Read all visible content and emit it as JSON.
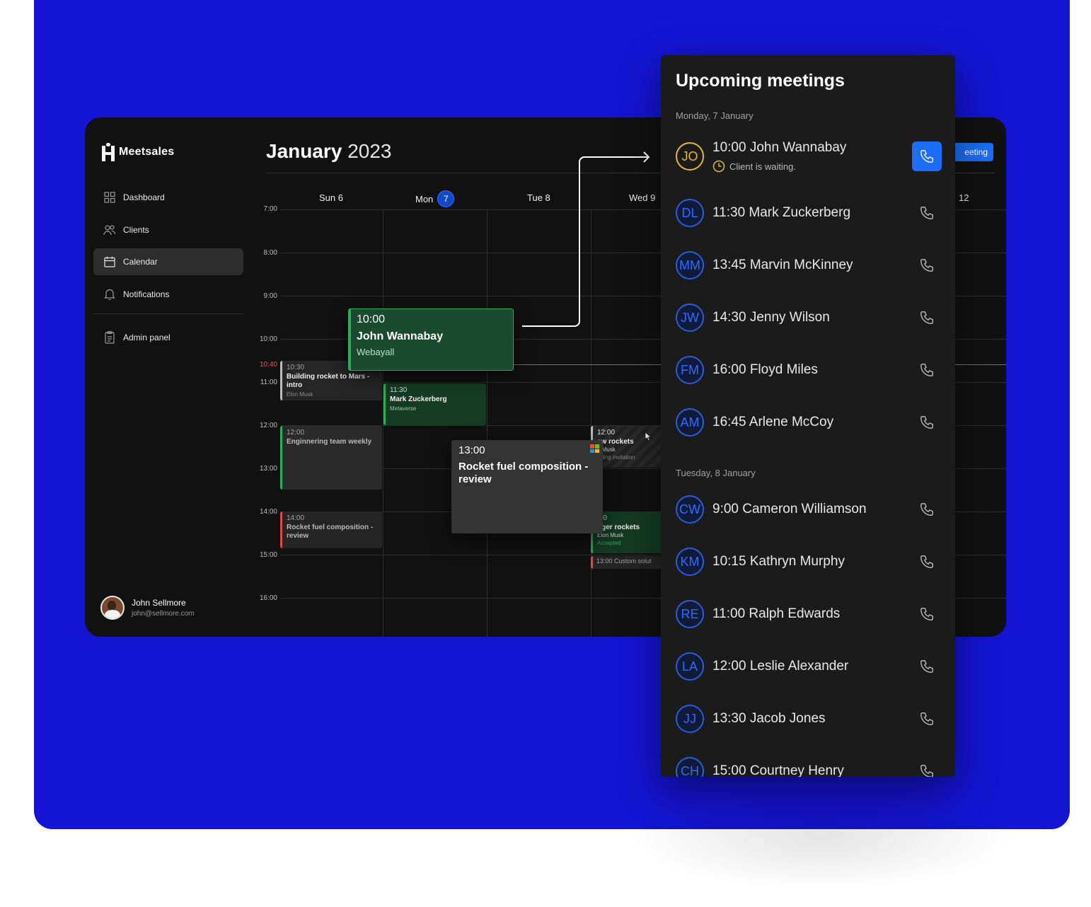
{
  "app": {
    "brand": "Meetsales",
    "nav": [
      {
        "label": "Dashboard",
        "icon": "grid-icon"
      },
      {
        "label": "Clients",
        "icon": "users-icon"
      },
      {
        "label": "Calendar",
        "icon": "calendar-icon",
        "active": true
      },
      {
        "label": "Notifications",
        "icon": "bell-icon"
      }
    ],
    "admin": {
      "label": "Admin panel",
      "icon": "clipboard-icon"
    },
    "user": {
      "name": "John Sellmore",
      "email": "john@sellmore.com"
    }
  },
  "calendar": {
    "month": "January",
    "year": "2023",
    "new_button": "eeting",
    "days": [
      {
        "label": "Sun 6"
      },
      {
        "label": "Mon",
        "badge": "7"
      },
      {
        "label": "Tue 8"
      },
      {
        "label": "Wed 9"
      },
      {
        "label": "12"
      }
    ],
    "times": [
      "7:00",
      "8:00",
      "9:00",
      "10:00",
      "11:00",
      "12:00",
      "13:00",
      "14:00",
      "15:00",
      "16:00"
    ],
    "now": "10:40",
    "events": {
      "building": {
        "time": "10:30",
        "title": "Building rocket to Mars - intro",
        "sub": "Elon Musk"
      },
      "markz": {
        "time": "11:30",
        "title": "Mark Zuckerberg",
        "sub": "Metaverse"
      },
      "eng": {
        "time": "12:00",
        "title": "Enginnering team weekly"
      },
      "rfc_small": {
        "time": "14:00",
        "title": "Rocket fuel composition - review"
      },
      "newrockets": {
        "time": "12:00",
        "title": "ew rockets",
        "sub": "n Musk",
        "sub2": "nding invitation"
      },
      "bigger": {
        "time": ":00",
        "title": "gger rockets",
        "sub": "Elon Musk",
        "sub2": "Accepted"
      },
      "custom": {
        "label": "13:00 Custom solut"
      }
    },
    "drag_green": {
      "time": "10:00",
      "name": "John Wannabay",
      "company": "Webayall"
    },
    "drag_gray": {
      "time": "13:00",
      "title": "Rocket fuel composition - review"
    }
  },
  "upcoming": {
    "title": "Upcoming meetings",
    "groups": [
      {
        "date": "Monday, 7 January"
      },
      {
        "date": "Tuesday, 8 January"
      }
    ],
    "first": {
      "initials": "JO",
      "text": "10:00 John Wannabay",
      "status": "Client is waiting."
    },
    "mon": [
      {
        "initials": "DL",
        "text": "11:30 Mark Zuckerberg"
      },
      {
        "initials": "MM",
        "text": "13:45 Marvin McKinney"
      },
      {
        "initials": "JW",
        "text": "14:30 Jenny Wilson"
      },
      {
        "initials": "FM",
        "text": "16:00 Floyd Miles"
      },
      {
        "initials": "AM",
        "text": "16:45 Arlene McCoy"
      }
    ],
    "tue": [
      {
        "initials": "CW",
        "text": "9:00 Cameron Williamson"
      },
      {
        "initials": "KM",
        "text": "10:15 Kathryn Murphy"
      },
      {
        "initials": "RE",
        "text": "11:00 Ralph Edwards"
      },
      {
        "initials": "LA",
        "text": "12:00 Leslie Alexander"
      },
      {
        "initials": "JJ",
        "text": "13:30 Jacob Jones"
      },
      {
        "initials": "CH",
        "text": "15:00 Courtney Henry"
      }
    ]
  },
  "colors": {
    "accent": "#1b6ef5",
    "background": "#1414d2",
    "waiting": "#e2b92d",
    "now_line": "#e34646",
    "event_green": "#2cab5a"
  }
}
